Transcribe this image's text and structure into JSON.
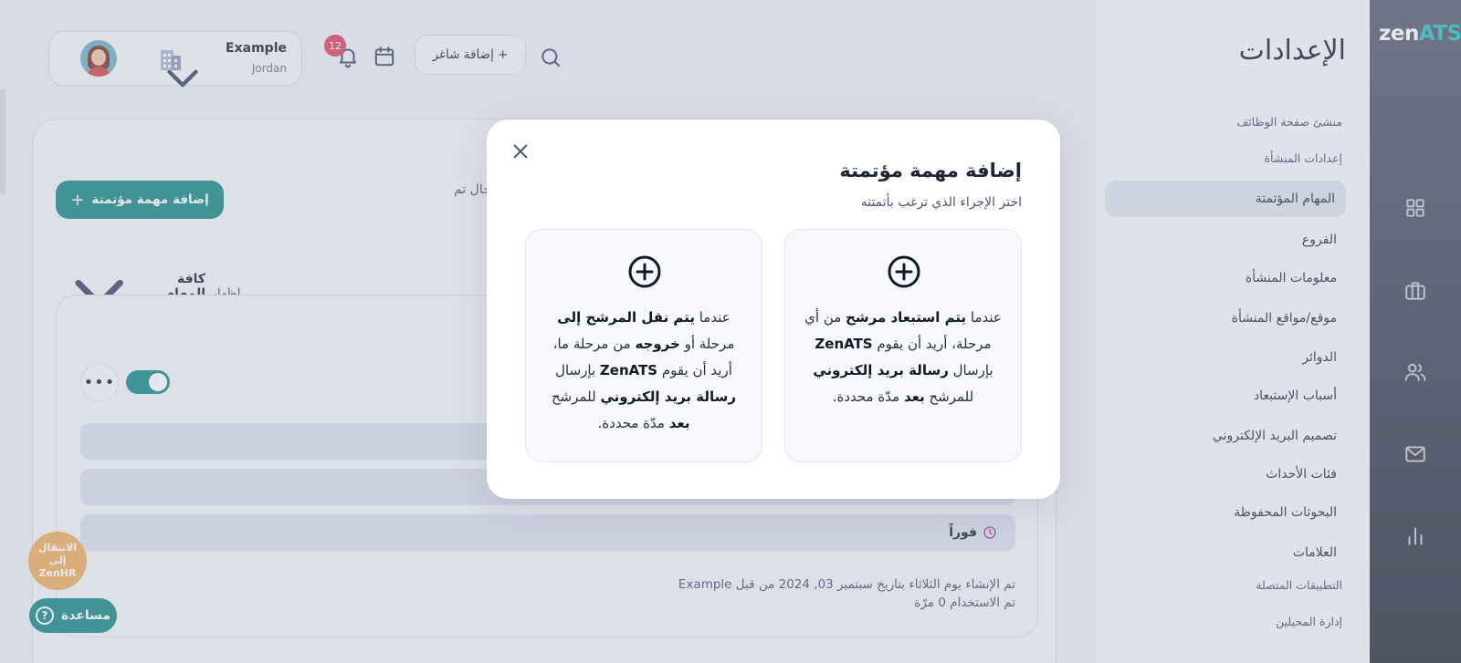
{
  "brand": {
    "logo_zen": "zen",
    "logo_ats": "ATS",
    "accent": "#1c8b86",
    "accent_light": "#2ec4c0"
  },
  "rail": {
    "icons": [
      "grid-icon",
      "briefcase-icon",
      "users-icon",
      "mail-icon",
      "chart-icon"
    ]
  },
  "settings": {
    "title": "الإعدادات",
    "items": [
      {
        "label": "منشئ صفحة الوظائف",
        "type": "section"
      },
      {
        "label": "إعدادات المنشأة",
        "type": "section"
      },
      {
        "label": "المهام المؤتمتة",
        "type": "item",
        "active": true
      },
      {
        "label": "الفروع",
        "type": "item"
      },
      {
        "label": "معلومات المنشأة",
        "type": "item"
      },
      {
        "label": "موقع/مواقع المنشأة",
        "type": "item"
      },
      {
        "label": "الدوائر",
        "type": "item"
      },
      {
        "label": "أسباب الإستبعاد",
        "type": "item"
      },
      {
        "label": "تصميم البريد الإلكتروني",
        "type": "item"
      },
      {
        "label": "فئات الأحداث",
        "type": "item"
      },
      {
        "label": "البحوثات المحفوظة",
        "type": "item"
      },
      {
        "label": "العلامات",
        "type": "item"
      },
      {
        "label": "التطبيقات المتصلة",
        "type": "section"
      },
      {
        "label": "إدارة المحيلين",
        "type": "section"
      }
    ]
  },
  "topbar": {
    "profile_name": "Example",
    "profile_location": "Jordan",
    "notification_count": "12",
    "add_job_label": "+ إضافة شاغر"
  },
  "main": {
    "add_auto_task_label": "إضافة مهمة مؤتمتة",
    "truncated_text": "حال تم",
    "filter_label": "إظهار",
    "filter_value": "كافة المهام المؤتمتة",
    "dots": "•••",
    "timing_label": "فوراً",
    "created_line": "تم الإنشاء يوم الثلاثاء بتاريخ سبتمبر 03, 2024 من قبل Example",
    "usage_line": "تم الاستخدام 0 مرّة"
  },
  "floating": {
    "zenhr_line1": "الانتقال إلى",
    "zenhr_line2": "ZenHR",
    "help_label": "مساعدة",
    "help_icon": "?"
  },
  "modal": {
    "title": "إضافة مهمة مؤتمتة",
    "subtitle": "اختر الإجراء الذي ترغب بأتمتته",
    "option1": {
      "t1": "عندما ",
      "b1": "يتم استبعاد مرشح",
      "t2": " من أي مرحلة، أريد أن يقوم ",
      "b2": "ZenATS",
      "t3": " بإرسال ",
      "b3": "رسالة بريد إلكتروني",
      "t4": " للمرشح ",
      "b4": "بعد",
      "t5": " مدّة محددة."
    },
    "option2": {
      "t1": "عندما ",
      "b1": "يتم نقل المرشح إلى",
      "t2": " مرحلة أو ",
      "b2": "خروجه",
      "t3": " من مرحلة ما، أريد أن يقوم ",
      "b3": "ZenATS",
      "t4": " بإرسال ",
      "b4": "رسالة بريد إلكتروني",
      "t5": " للمرشح ",
      "b5": "بعد",
      "t6": " مدّة محددة."
    }
  }
}
